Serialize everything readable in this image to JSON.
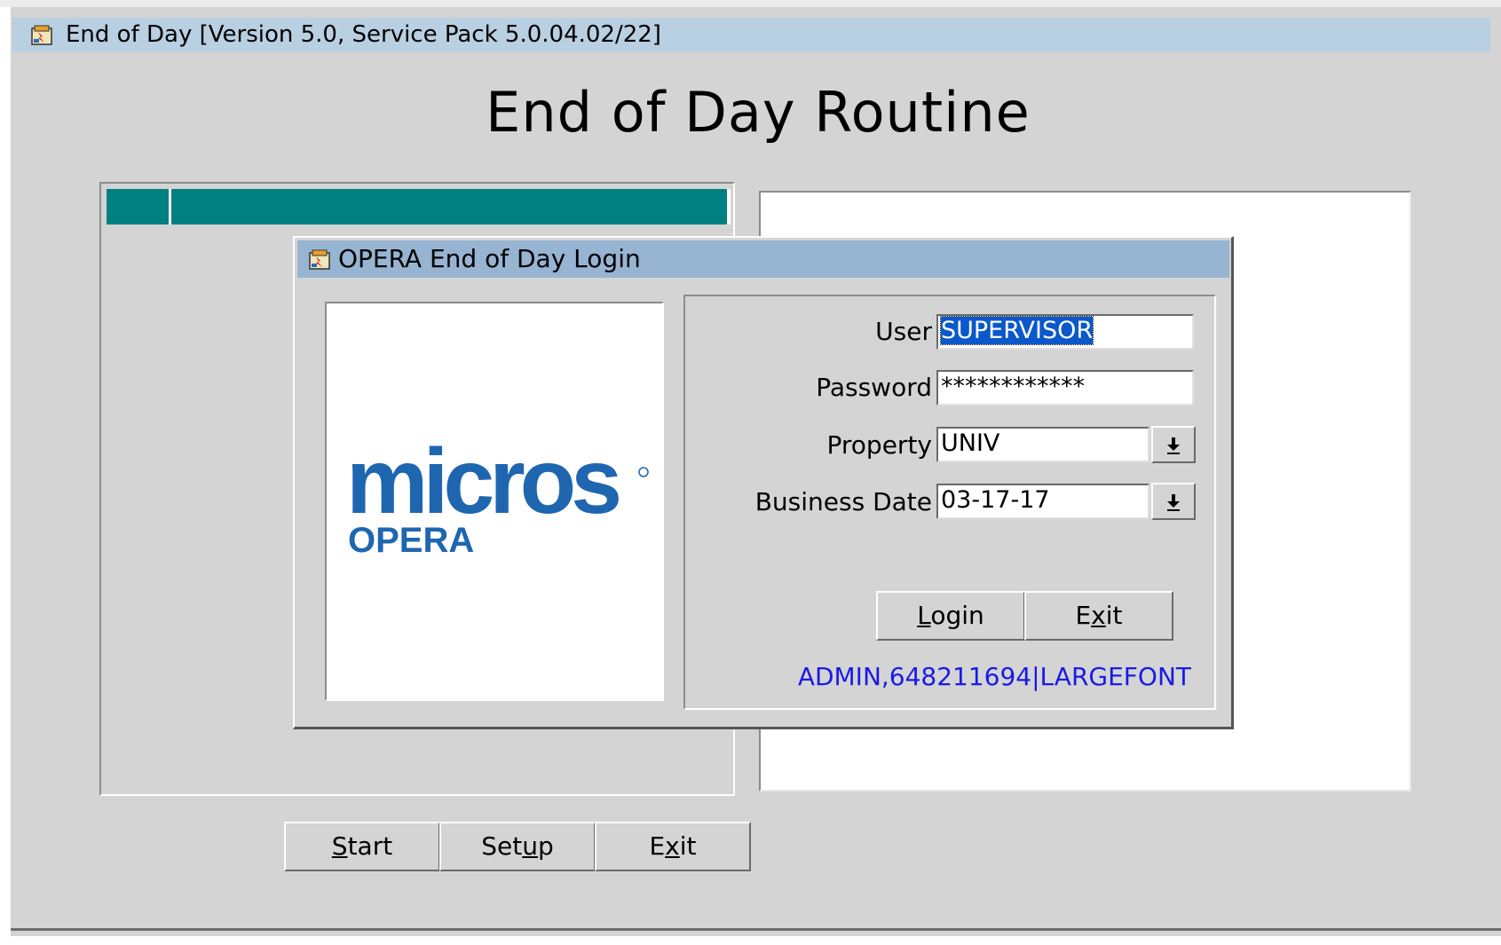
{
  "main_window": {
    "title": "End of Day [Version 5.0, Service Pack 5.0.04.02/22]",
    "heading": "End of Day Routine",
    "buttons": {
      "start": {
        "pre": "",
        "mnemonic": "S",
        "post": "tart"
      },
      "setup": {
        "pre": "Set",
        "mnemonic": "u",
        "post": "p"
      },
      "exit": {
        "pre": "E",
        "mnemonic": "x",
        "post": "it"
      }
    }
  },
  "login_dialog": {
    "title": "OPERA End of Day Login",
    "logo": {
      "brand": "micros",
      "product": "OPERA",
      "brand_color": "#1f66b0"
    },
    "fields": {
      "user": {
        "label": "User",
        "value": "SUPERVISOR"
      },
      "password": {
        "label": "Password",
        "value": "************"
      },
      "property": {
        "label": "Property",
        "value": "UNIV"
      },
      "business_date": {
        "label": "Business Date",
        "value": "03-17-17"
      }
    },
    "buttons": {
      "login": {
        "pre": "",
        "mnemonic": "L",
        "post": "ogin"
      },
      "exit": {
        "pre": "E",
        "mnemonic": "x",
        "post": "it"
      }
    },
    "info": "ADMIN,648211694|LARGEFONT"
  },
  "icons": {
    "app_icon": "opera-app-icon",
    "dropdown_icon": "down-arrow-icon"
  },
  "colors": {
    "grid_header": "#008080",
    "titlebar_main": "#b9cfe2",
    "titlebar_dialog": "#97b4d2",
    "info_text": "#1a1ae6",
    "selection": "#0a58ca"
  }
}
